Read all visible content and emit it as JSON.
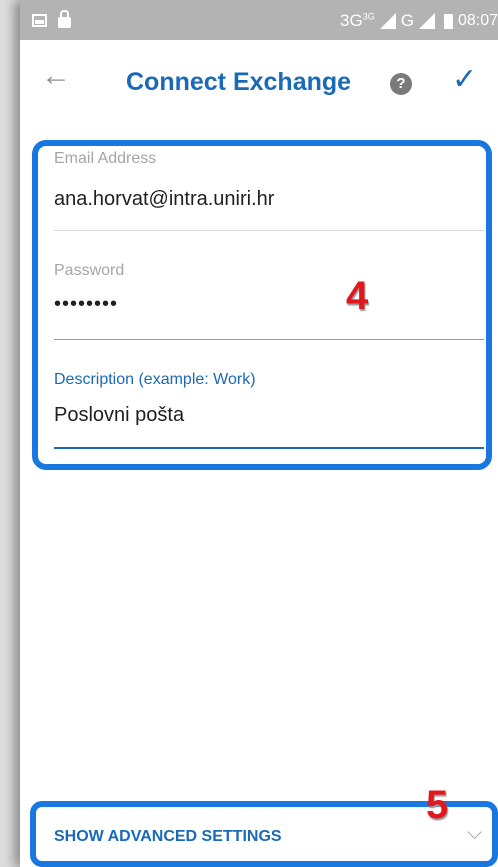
{
  "status_bar": {
    "network": "3G",
    "network_sup": "3G",
    "network2": "G",
    "time": "08:07"
  },
  "app_bar": {
    "back_icon": "arrow-back-icon",
    "title": "Connect Exchange",
    "help_icon": "help-circle-icon",
    "help_glyph": "?",
    "confirm_icon": "checkmark-icon"
  },
  "form": {
    "email": {
      "label": "Email Address",
      "value": "ana.horvat@intra.uniri.hr"
    },
    "password": {
      "label": "Password",
      "value": "••••••••"
    },
    "description": {
      "label": "Description (example: Work)",
      "value": "Poslovni pošta"
    }
  },
  "annotations": {
    "marker_form": "4",
    "marker_advanced": "5"
  },
  "advanced": {
    "label": "SHOW ADVANCED SETTINGS",
    "icon": "chevron-down-icon"
  },
  "colors": {
    "accent": "#1a6ab8",
    "highlight_border": "#1878e0",
    "marker_red": "#e3161e",
    "status_bar": "#b3b3b3"
  }
}
